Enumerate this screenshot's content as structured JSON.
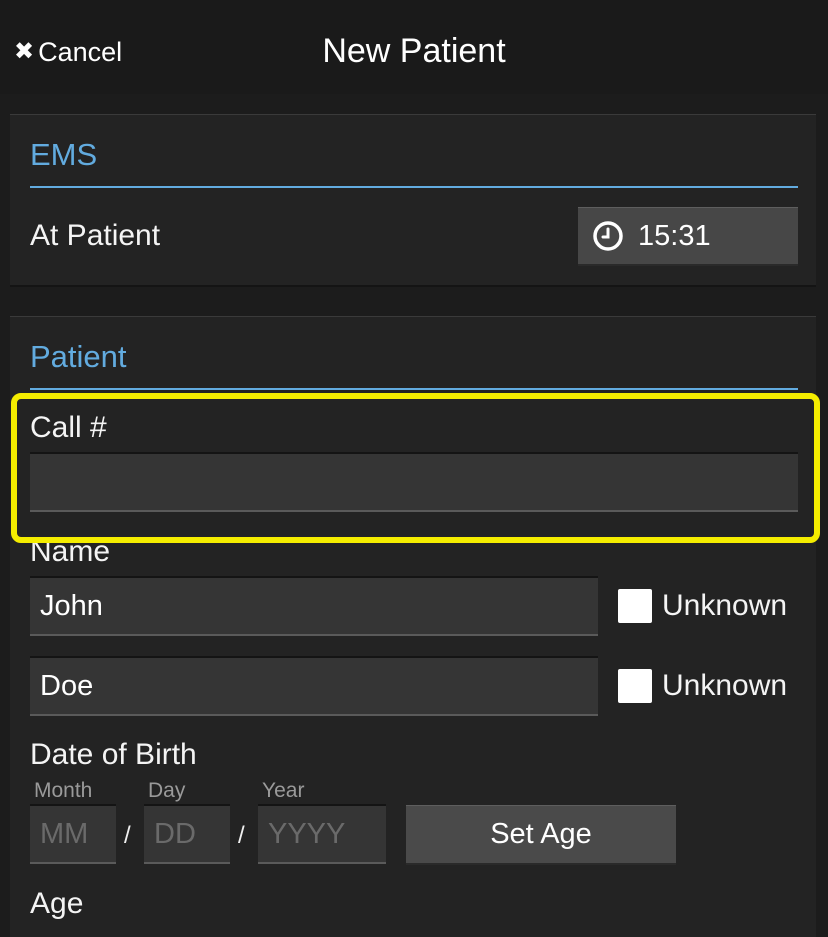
{
  "navbar": {
    "cancel_label": "Cancel",
    "title": "New Patient"
  },
  "ems": {
    "section_title": "EMS",
    "at_patient_label": "At Patient",
    "at_patient_time": "15:31"
  },
  "patient": {
    "section_title": "Patient",
    "call_label": "Call #",
    "call_value": "",
    "name_label": "Name",
    "first_name": "John",
    "last_name": "Doe",
    "unknown_label": "Unknown",
    "dob_label": "Date of Birth",
    "month_label": "Month",
    "day_label": "Day",
    "year_label": "Year",
    "month_placeholder": "MM",
    "day_placeholder": "DD",
    "year_placeholder": "YYYY",
    "date_separator": "/",
    "set_age_label": "Set Age",
    "age_label": "Age"
  },
  "colors": {
    "accent": "#62abdf",
    "highlight": "#f5ed00",
    "background": "#1c1c1c"
  }
}
